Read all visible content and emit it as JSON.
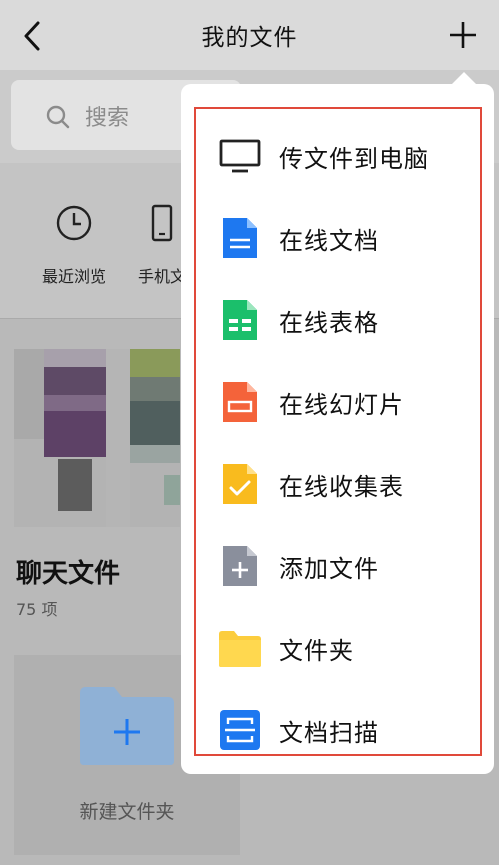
{
  "header": {
    "title": "我的文件"
  },
  "search": {
    "placeholder": "搜索"
  },
  "quick_access": [
    {
      "label": "最近浏览",
      "icon": "clock-icon"
    },
    {
      "label": "手机文",
      "icon": "phone-icon"
    }
  ],
  "chat_files": {
    "title": "聊天文件",
    "count": "75 项"
  },
  "new_folder": {
    "label": "新建文件夹"
  },
  "menu": {
    "items": [
      {
        "label": "传文件到电脑",
        "icon": "monitor-icon",
        "color": "#222222"
      },
      {
        "label": "在线文档",
        "icon": "online-doc-icon",
        "color": "#1e78f0"
      },
      {
        "label": "在线表格",
        "icon": "online-sheet-icon",
        "color": "#1bbf6b"
      },
      {
        "label": "在线幻灯片",
        "icon": "online-slides-icon",
        "color": "#f4633a"
      },
      {
        "label": "在线收集表",
        "icon": "online-form-icon",
        "color": "#f9bb1e"
      },
      {
        "label": "添加文件",
        "icon": "add-file-icon",
        "color": "#8a8f9c"
      },
      {
        "label": "文件夹",
        "icon": "folder-icon",
        "color": "#fccd3d"
      },
      {
        "label": "文档扫描",
        "icon": "doc-scan-icon",
        "color": "#1e78f0"
      }
    ],
    "highlight_color": "#e0493a"
  }
}
